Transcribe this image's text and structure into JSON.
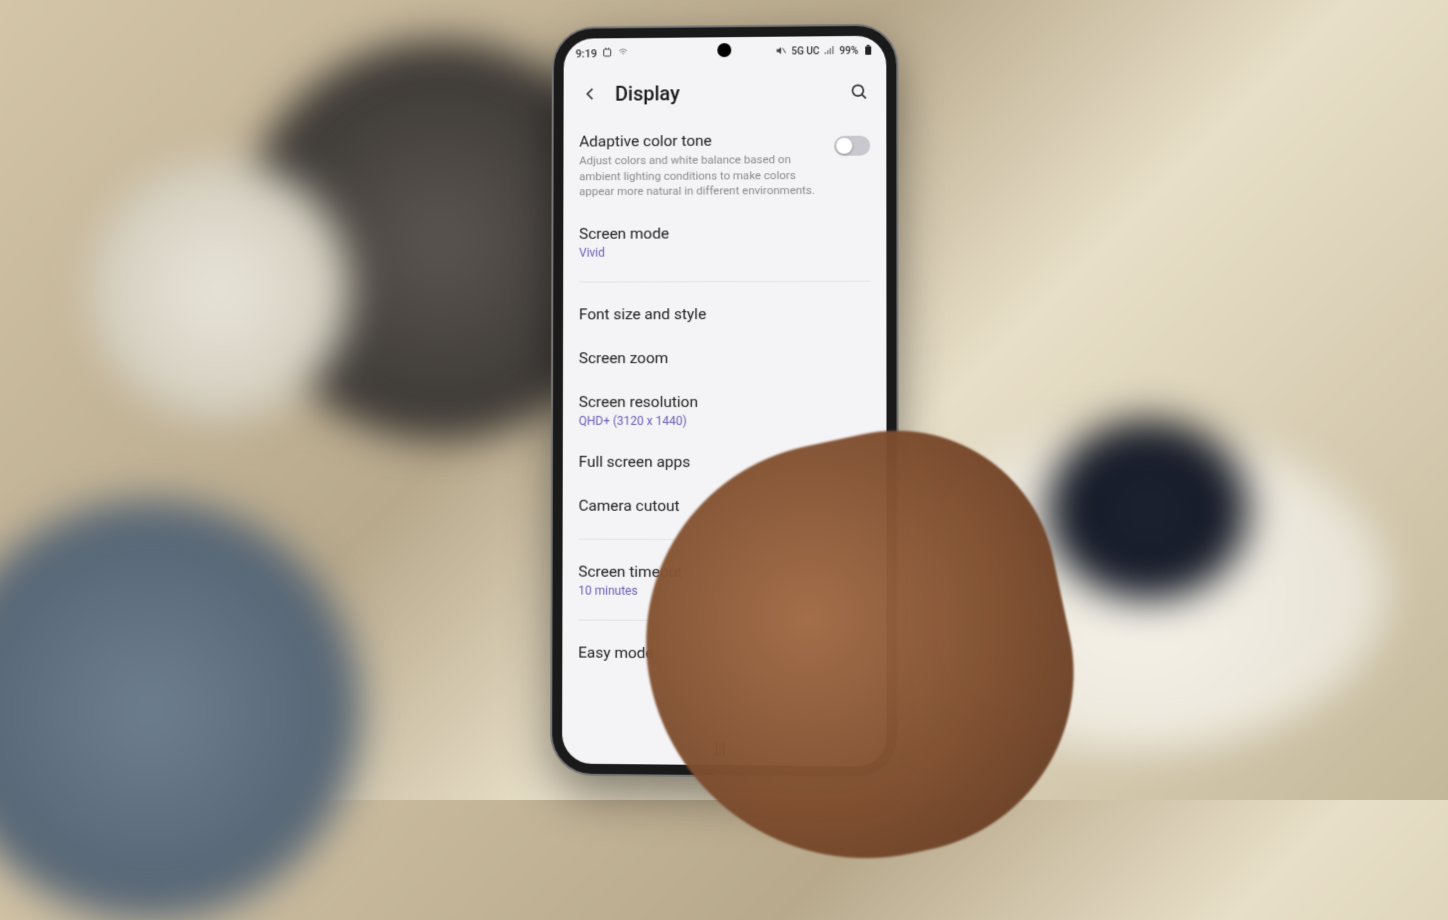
{
  "status": {
    "time": "9:19",
    "network": "5G UC",
    "battery": "99%"
  },
  "header": {
    "title": "Display"
  },
  "items": {
    "adaptive": {
      "title": "Adaptive color tone",
      "desc": "Adjust colors and white balance based on ambient lighting conditions to make colors appear more natural in different environments."
    },
    "screenMode": {
      "title": "Screen mode",
      "value": "Vivid"
    },
    "font": {
      "title": "Font size and style"
    },
    "zoom": {
      "title": "Screen zoom"
    },
    "resolution": {
      "title": "Screen resolution",
      "value": "QHD+ (3120 x 1440)"
    },
    "fullscreen": {
      "title": "Full screen apps"
    },
    "cutout": {
      "title": "Camera cutout"
    },
    "timeout": {
      "title": "Screen timeout",
      "value": "10 minutes"
    },
    "easy": {
      "title": "Easy mode"
    }
  }
}
